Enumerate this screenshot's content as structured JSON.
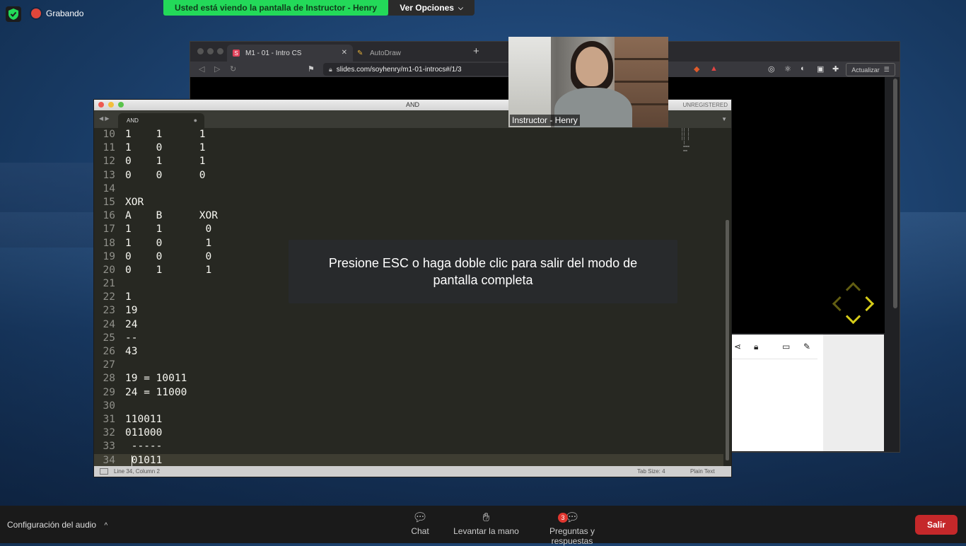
{
  "zoom": {
    "recording_label": "Grabando",
    "share_banner": "Usted está viendo la pantalla de Instructor - Henry",
    "view_options": "Ver Opciones",
    "video_label": "Instructor - Henry",
    "fullscreen_message": "Presione ESC o haga doble clic para salir del modo de pantalla completa",
    "bottom": {
      "audio_config": "Configuración del audio",
      "chat": "Chat",
      "raise_hand": "Levantar la mano",
      "qa": "Preguntas y respuestas",
      "qa_badge": "3",
      "exit": "Salir",
      "exit_color": "#c5282a"
    },
    "banner_color": "#23d959"
  },
  "browser": {
    "tabs": [
      {
        "label": "M1 - 01 - Intro CS",
        "favicon": "S"
      },
      {
        "label": "AutoDraw"
      }
    ],
    "url": "slides.com/soyhenry/m1-01-introcs#/1/3",
    "update_button": "Actualizar",
    "arrow_color": "#d6cc19"
  },
  "editor": {
    "title": "AND",
    "unregistered": "UNREGISTERED",
    "tab_label": "AND",
    "lines": [
      {
        "n": "10",
        "t": "1    1      1"
      },
      {
        "n": "11",
        "t": "1    0      1"
      },
      {
        "n": "12",
        "t": "0    1      1"
      },
      {
        "n": "13",
        "t": "0    0      0"
      },
      {
        "n": "14",
        "t": ""
      },
      {
        "n": "15",
        "t": "XOR"
      },
      {
        "n": "16",
        "t": "A    B      XOR"
      },
      {
        "n": "17",
        "t": "1    1       0"
      },
      {
        "n": "18",
        "t": "1    0       1"
      },
      {
        "n": "19",
        "t": "0    0       0"
      },
      {
        "n": "20",
        "t": "0    1       1"
      },
      {
        "n": "21",
        "t": ""
      },
      {
        "n": "22",
        "t": "1"
      },
      {
        "n": "23",
        "t": "19"
      },
      {
        "n": "24",
        "t": "24"
      },
      {
        "n": "25",
        "t": "--"
      },
      {
        "n": "26",
        "t": "43"
      },
      {
        "n": "27",
        "t": ""
      },
      {
        "n": "28",
        "t": "19 = 10011"
      },
      {
        "n": "29",
        "t": "24 = 11000"
      },
      {
        "n": "30",
        "t": ""
      },
      {
        "n": "31",
        "t": "110011"
      },
      {
        "n": "32",
        "t": "011000"
      },
      {
        "n": "33",
        "t": " -----"
      },
      {
        "n": "34",
        "t": " 01011"
      }
    ],
    "current_line": "34",
    "status": {
      "position": "Line 34, Column 2",
      "tab_size": "Tab Size: 4",
      "syntax": "Plain Text"
    }
  }
}
